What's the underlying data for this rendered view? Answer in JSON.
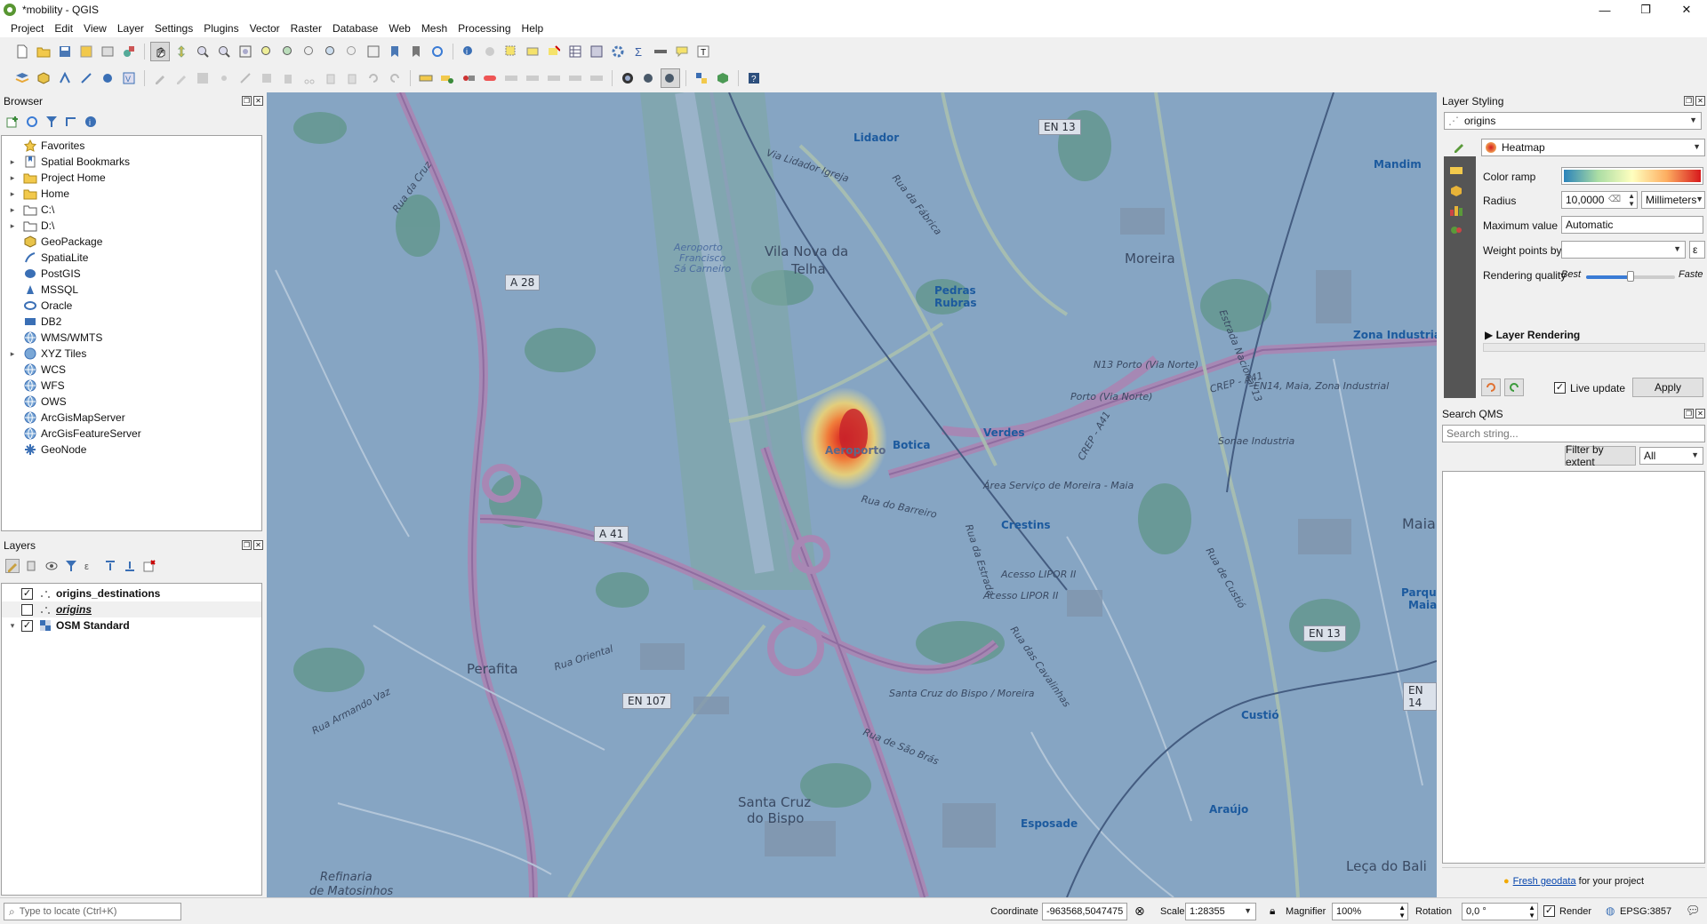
{
  "window": {
    "title": "*mobility - QGIS",
    "minimize": "—",
    "restore": "❐",
    "close": "✕"
  },
  "menu": [
    "Project",
    "Edit",
    "View",
    "Layer",
    "Settings",
    "Plugins",
    "Vector",
    "Raster",
    "Database",
    "Web",
    "Mesh",
    "Processing",
    "Help"
  ],
  "browser": {
    "title": "Browser",
    "items": [
      {
        "label": "Favorites",
        "icon": "star-icon",
        "expandable": false
      },
      {
        "label": "Spatial Bookmarks",
        "icon": "bookmark-icon",
        "expandable": true
      },
      {
        "label": "Project Home",
        "icon": "folder-icon",
        "expandable": true
      },
      {
        "label": "Home",
        "icon": "folder-icon",
        "expandable": true
      },
      {
        "label": "C:\\",
        "icon": "drive-icon",
        "expandable": true
      },
      {
        "label": "D:\\",
        "icon": "drive-icon",
        "expandable": true
      },
      {
        "label": "GeoPackage",
        "icon": "geopackage-icon",
        "expandable": false
      },
      {
        "label": "SpatiaLite",
        "icon": "spatialite-icon",
        "expandable": false
      },
      {
        "label": "PostGIS",
        "icon": "postgis-icon",
        "expandable": false
      },
      {
        "label": "MSSQL",
        "icon": "mssql-icon",
        "expandable": false
      },
      {
        "label": "Oracle",
        "icon": "oracle-icon",
        "expandable": false
      },
      {
        "label": "DB2",
        "icon": "db2-icon",
        "expandable": false
      },
      {
        "label": "WMS/WMTS",
        "icon": "globe-icon",
        "expandable": false
      },
      {
        "label": "XYZ Tiles",
        "icon": "grid-icon",
        "expandable": true
      },
      {
        "label": "WCS",
        "icon": "globe-icon",
        "expandable": false
      },
      {
        "label": "WFS",
        "icon": "globe-icon",
        "expandable": false
      },
      {
        "label": "OWS",
        "icon": "globe-icon",
        "expandable": false
      },
      {
        "label": "ArcGisMapServer",
        "icon": "globe-icon",
        "expandable": false
      },
      {
        "label": "ArcGisFeatureServer",
        "icon": "globe-icon",
        "expandable": false
      },
      {
        "label": "GeoNode",
        "icon": "geonode-icon",
        "expandable": false
      }
    ]
  },
  "layers": {
    "title": "Layers",
    "items": [
      {
        "label": "origins_destinations",
        "checked": true
      },
      {
        "label": "origins",
        "checked": false
      },
      {
        "label": "OSM Standard",
        "checked": true
      }
    ]
  },
  "map": {
    "labels": {
      "lidador": "Lidador",
      "vila_nova": "Vila Nova da",
      "telha": "Telha",
      "moreira": "Moreira",
      "mandim": "Mandim",
      "pedras": "Pedras",
      "rubras": "Rubras",
      "aeroporto_small": "Aeroporto",
      "francisco": "Francisco",
      "sa_carneiro": "Sá Carneiro",
      "aeroporto": "Aeroporto",
      "botica": "Botica",
      "verdes": "Verdes",
      "crestins": "Crestins",
      "zona_industrial": "Zona Industria",
      "maia": "Maia",
      "perafita": "Perafita",
      "santa_cruz": "Santa Cruz",
      "do_bispo": "do Bispo",
      "custio": "Custió",
      "esposade": "Esposade",
      "araujo": "Araújo",
      "leca": "Leça do Bali",
      "refinaria": "Refinaria",
      "matosinhos": "de Matosinhos",
      "parque": "Parqu",
      "parque_maia": "Maia",
      "area_servico": "Área Serviço de Moreira - Maia",
      "acesso1": "Acesso LIPOR II",
      "acesso2": "Acesso LIPOR II",
      "santa_cruz_bispo": "Santa Cruz do Bispo / Moreira",
      "rua_barreiro": "Rua do Barreiro",
      "rua_oriental": "Rua Oriental",
      "rua_cruz": "Rua da Cruz",
      "rua_fabrica": "Rua da Fábrica",
      "via_lidador": "Via Lidador Igreja",
      "rua_sao_bras": "Rua de São Brás",
      "rua_custio": "Rua de Custió",
      "rua_estrada": "Rua da Estrada",
      "rua_cavalinhas": "Rua das Cavalinhas",
      "rua_armando": "Rua Armando Vaz",
      "n13": "N13 Porto (Via Norte)",
      "porto_via_norte": "Porto (Via Norte)",
      "en14": "EN14, Maia, Zona Industrial",
      "sonae": "Sonae Industria",
      "estrada_nacional": "Estrada Nacional 13",
      "crep_a41": "CREP - A41",
      "crep_a41b": "CREP - A41"
    },
    "shields": {
      "en13_top": "EN 13",
      "a28": "A 28",
      "a41": "A 41",
      "en107": "EN 107",
      "en13_right": "EN 13",
      "en14": "EN 14"
    }
  },
  "layer_styling": {
    "title": "Layer Styling",
    "layer": "origins",
    "renderer": "Heatmap",
    "color_ramp_label": "Color ramp",
    "radius_label": "Radius",
    "radius_value": "10,0000",
    "radius_unit": "Millimeters",
    "max_value_label": "Maximum value",
    "max_value": "Automatic",
    "weight_label": "Weight points by",
    "weight_value": "",
    "quality_label": "Rendering quality",
    "quality_best": "Best",
    "quality_fast": "Faste",
    "quality_level": 0.5,
    "layer_rendering": "Layer Rendering",
    "live_update": "Live update",
    "live_update_checked": true,
    "apply": "Apply"
  },
  "search_qms": {
    "title": "Search QMS",
    "placeholder": "Search string...",
    "filter_btn": "Filter by extent",
    "filter_value": "All",
    "footer_link": "Fresh geodata",
    "footer_text": " for your project"
  },
  "status": {
    "locate_placeholder": "Type to locate (Ctrl+K)",
    "coordinate_label": "Coordinate",
    "coordinate": "-963568,5047475",
    "scale_label": "Scale",
    "scale": "1:28355",
    "magnifier_label": "Magnifier",
    "magnifier": "100%",
    "rotation_label": "Rotation",
    "rotation": "0,0 °",
    "render_label": "Render",
    "render_checked": true,
    "crs": "EPSG:3857"
  }
}
